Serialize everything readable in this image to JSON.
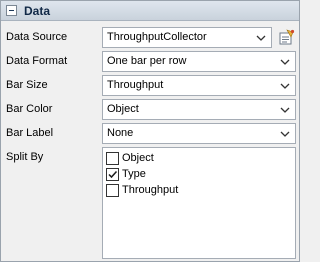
{
  "section": {
    "title": "Data"
  },
  "fields": {
    "data_source": {
      "label": "Data Source",
      "value": "ThroughputCollector"
    },
    "data_format": {
      "label": "Data Format",
      "value": "One bar per row"
    },
    "bar_size": {
      "label": "Bar Size",
      "value": "Throughput"
    },
    "bar_color": {
      "label": "Bar Color",
      "value": "Object"
    },
    "bar_label": {
      "label": "Bar Label",
      "value": "None"
    }
  },
  "split_by": {
    "label": "Split By",
    "options": [
      {
        "label": "Object",
        "checked": false
      },
      {
        "label": "Type",
        "checked": true
      },
      {
        "label": "Throughput",
        "checked": false
      }
    ]
  },
  "icons": {
    "collapse": "minus-box-icon",
    "dropdown": "chevron-down-icon",
    "settings": "properties-icon"
  }
}
